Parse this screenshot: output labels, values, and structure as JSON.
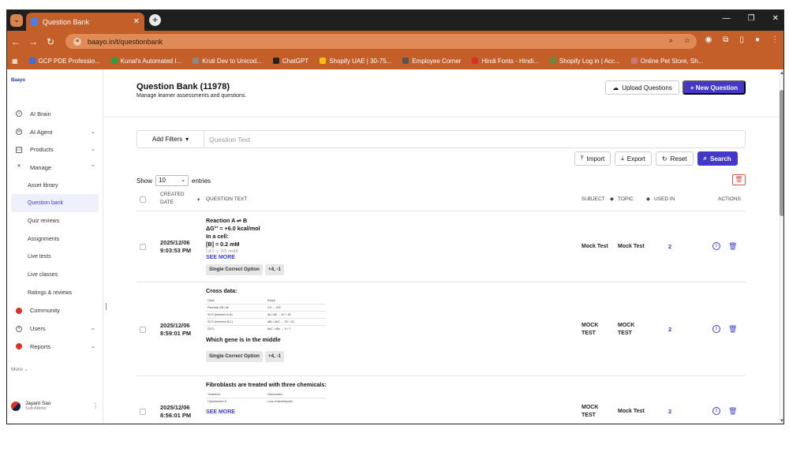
{
  "browser": {
    "tab_title": "Question Bank",
    "url": "baayo.in/t/questionbank",
    "bookmarks": [
      {
        "label": "GCP PDE Professio...",
        "color": "#3b6fe0"
      },
      {
        "label": "Kunal's Automated I...",
        "color": "#2e9d44"
      },
      {
        "label": "Kruti Dev to Unicod...",
        "color": "#888"
      },
      {
        "label": "ChatGPT",
        "color": "#222"
      },
      {
        "label": "Shopify UAE | 30-75...",
        "color": "#f4c20d"
      },
      {
        "label": "Employee Corner",
        "color": "#555"
      },
      {
        "label": "Hindi Fonts - Hindi...",
        "color": "#d93025"
      },
      {
        "label": "Shopify Log in | Acc...",
        "color": "#5e8e3e"
      },
      {
        "label": "Online Pet Store, Sh...",
        "color": "#c77"
      }
    ]
  },
  "sidebar": {
    "logo": "Baayo",
    "items": [
      {
        "label": "AI Brain",
        "icon": "info-circle-icon",
        "chev": ""
      },
      {
        "label": "AI Agent",
        "icon": "infinity-icon",
        "chev": "⌄"
      },
      {
        "label": "Products",
        "icon": "box-icon",
        "chev": "⌄"
      },
      {
        "label": "Manage",
        "icon": "tools-icon",
        "chev": "⌃"
      }
    ],
    "manage_sub": [
      "Asset library",
      "Question bank",
      "Quiz reviews",
      "Assignments",
      "Live tests",
      "Live classes",
      "Ratings & reviews"
    ],
    "items2": [
      {
        "label": "Community",
        "icon": "community-icon",
        "chev": ""
      },
      {
        "label": "Users",
        "icon": "user-icon",
        "chev": "⌄"
      },
      {
        "label": "Reports",
        "icon": "reports-icon",
        "chev": "⌄"
      }
    ],
    "more": "More",
    "user_name": "Jayant Sao",
    "user_role": "Sub Admin"
  },
  "header": {
    "title": "Question Bank (11978)",
    "subtitle": "Manage learner assessments and questions.",
    "upload_label": "Upload Questions",
    "new_label": "+ New Question"
  },
  "filters": {
    "add_filters": "Add Filters",
    "search_placeholder": "Question Text"
  },
  "actions": {
    "import": "Import",
    "export": "Export",
    "reset": "Reset",
    "search": "Search"
  },
  "entries": {
    "show": "Show",
    "value": "10",
    "suffix": "entries"
  },
  "table": {
    "headers": {
      "created_date": "CREATED DATE",
      "question_text": "QUESTION TEXT",
      "subject": "SUBJECT",
      "topic": "TOPIC",
      "used_in": "USED IN",
      "actions": "ACTIONS"
    },
    "rows": [
      {
        "date": "2025/12/06",
        "time": "9:03:53 PM",
        "lines": [
          "Reaction A ⇌ B",
          "ΔG°′ = +6.0 kcal/mol",
          "In a cell:",
          "[B] = 0.2 mM"
        ],
        "faded": "[A] = 20 mM",
        "see_more": "SEE MORE",
        "chips": [
          "Single Correct Option",
          "+4, -1"
        ],
        "subject": "Mock Test",
        "topic": "Mock Test",
        "used": "2"
      },
      {
        "date": "2025/12/06",
        "time": "8:59:01 PM",
        "intro": "Cross data:",
        "mini_head": [
          "Class",
          "Result"
        ],
        "mini_rows": [
          [
            "Parental: AB / ab",
            "2:0 → 200"
          ],
          [
            "SCO (between A-B)",
            "Ab / aB → 30 + 35"
          ],
          [
            "SCO (between B-C)",
            "aBc / AbC → 20 + 25"
          ],
          [
            "DCO",
            "AbC / aBc → 6 + 7"
          ]
        ],
        "outro": "Which gene is in the middle",
        "chips": [
          "Single Correct Option",
          "+4, -1"
        ],
        "subject": "MOCK TEST",
        "topic": "MOCK TEST",
        "used": "2"
      },
      {
        "date": "2025/12/06",
        "time": "8:56:01 PM",
        "intro": "Fibroblasts are treated with three chemicals:",
        "mini_head": [
          "Treatment",
          "Observation"
        ],
        "mini_rows": [
          [
            "Cytochalasin D",
            "Loss of lamellipodia"
          ]
        ],
        "see_more": "SEE MORE",
        "subject": "MOCK TEST",
        "topic": "Mock Test",
        "used": "2"
      }
    ]
  },
  "colors": {
    "accent": "#4338ca",
    "browser_orange": "#c45f2a",
    "link": "#3d3dd8",
    "danger": "#d9534f"
  }
}
